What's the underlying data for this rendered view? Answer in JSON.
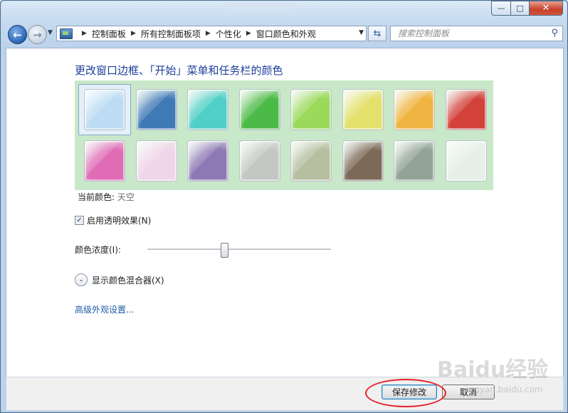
{
  "window": {
    "minimize_glyph": "—",
    "maximize_glyph": "□",
    "close_glyph": "✕"
  },
  "nav": {
    "breadcrumbs": [
      "控制面板",
      "所有控制面板项",
      "个性化",
      "窗口颜色和外观"
    ],
    "search_placeholder": "搜索控制面板"
  },
  "content": {
    "heading": "更改窗口边框、「开始」菜单和任务栏的颜色",
    "current_color_label": "当前颜色:",
    "current_color_value": "天空",
    "transparency_label": "启用透明效果(N)",
    "transparency_checked": true,
    "intensity_label": "颜色浓度(I):",
    "intensity_fraction": 0.42,
    "mixer_label": "显示颜色混合器(X)",
    "advanced_link": "高级外观设置..."
  },
  "swatches": [
    {
      "name": "sky",
      "color": "#bcdcf4",
      "selected": true
    },
    {
      "name": "twilight",
      "color": "#3f79b6"
    },
    {
      "name": "sea-foam",
      "color": "#4fcfc6"
    },
    {
      "name": "leaf",
      "color": "#4cba46"
    },
    {
      "name": "lime",
      "color": "#9bd95a"
    },
    {
      "name": "lemon",
      "color": "#e3e06b"
    },
    {
      "name": "tangerine",
      "color": "#efb441"
    },
    {
      "name": "ruby",
      "color": "#d2423a"
    },
    {
      "name": "fuchsia",
      "color": "#e06cb6"
    },
    {
      "name": "blush",
      "color": "#efd6ea"
    },
    {
      "name": "violet",
      "color": "#8f79b4"
    },
    {
      "name": "lavender",
      "color": "#c4c8c4"
    },
    {
      "name": "taupe",
      "color": "#b6bfa0"
    },
    {
      "name": "chocolate",
      "color": "#7c6a58"
    },
    {
      "name": "slate",
      "color": "#93a497"
    },
    {
      "name": "frost",
      "color": "#e7efe8"
    }
  ],
  "buttons": {
    "save": "保存修改",
    "cancel": "取消"
  },
  "watermark": {
    "main": "Baidu经验",
    "sub": "jingyan.baidu.com"
  }
}
